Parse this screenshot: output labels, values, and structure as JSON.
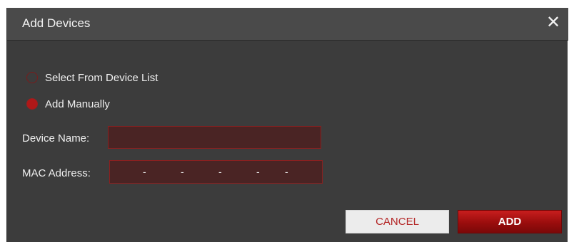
{
  "dialog": {
    "title": "Add Devices",
    "close_glyph": "✕"
  },
  "options": [
    {
      "label": "Select From Device List",
      "checked": false
    },
    {
      "label": "Add Manually",
      "checked": true
    }
  ],
  "form": {
    "device_name_label": "Device Name:",
    "device_name_value": "",
    "mac_label": "MAC Address:",
    "mac_segments": [
      "",
      "",
      "",
      "",
      "",
      ""
    ],
    "mac_separator": "-"
  },
  "buttons": {
    "cancel": "CANCEL",
    "add": "ADD"
  },
  "colors": {
    "accent": "#b01818",
    "dialog_bg": "#3c3c3c",
    "titlebar_bg": "#4a4a4a",
    "input_bg": "#4a2424",
    "input_border": "#8a2020"
  }
}
